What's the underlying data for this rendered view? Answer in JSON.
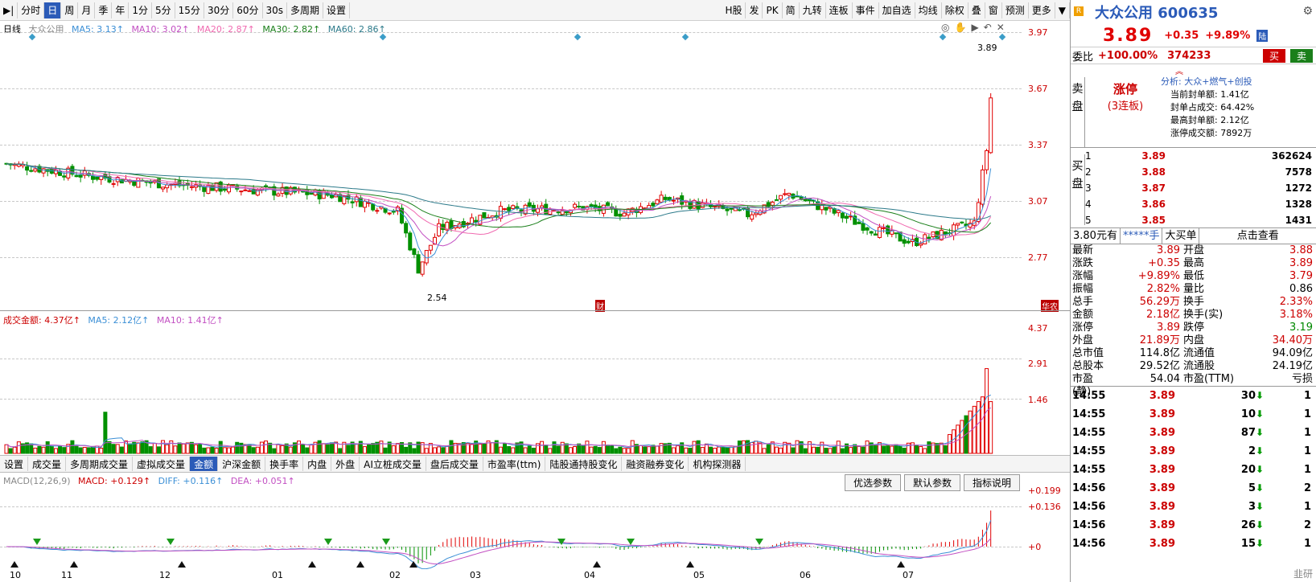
{
  "toolbar": {
    "left": [
      "分时",
      "日",
      "周",
      "月",
      "季",
      "年",
      "1分",
      "5分",
      "15分",
      "30分",
      "60分",
      "30s",
      "多周期",
      "设置"
    ],
    "active": "日",
    "right": [
      "H股",
      "发",
      "PK",
      "简",
      "九转",
      "连板",
      "事件",
      "加自选",
      "均线",
      "除权",
      "叠",
      "窗",
      "预测",
      "更多"
    ]
  },
  "price_pane": {
    "legend": {
      "name": "日线",
      "stock": "大众公用",
      "ma5": "MA5: 3.13↑",
      "ma10": "MA10: 3.02↑",
      "ma20": "MA20: 2.87↑",
      "ma30": "MA30: 2.82↑",
      "ma60": "MA60: 2.86↑"
    },
    "y_labels": [
      "3.97",
      "3.67",
      "3.37",
      "3.07",
      "2.77"
    ],
    "low_marker": "2.54",
    "last_marker": "3.89",
    "tag_cai": "财",
    "tag_ruixing": "华农"
  },
  "volume_pane": {
    "legend": {
      "amount": "成交金额: 4.37亿↑",
      "ma5": "MA5: 2.12亿↑",
      "ma10": "MA10: 1.41亿↑"
    },
    "y_labels": [
      "4.37",
      "2.91",
      "1.46"
    ]
  },
  "indicator_tabs": [
    "设置",
    "成交量",
    "多周期成交量",
    "虚拟成交量",
    "金额",
    "沪深金额",
    "换手率",
    "内盘",
    "外盘",
    "AI立桩成交量",
    "盘后成交量",
    "市盈率(ttm)",
    "陆股通持股变化",
    "融资融券变化",
    "机构探测器"
  ],
  "indicator_active": "金额",
  "macd_pane": {
    "legend": {
      "name": "MACD(12,26,9)",
      "macd": "MACD: +0.129↑",
      "diff": "DIFF: +0.116↑",
      "dea": "DEA: +0.051↑"
    },
    "buttons": [
      "优选参数",
      "默认参数",
      "指标说明"
    ],
    "y_labels": [
      "+0.199",
      "+0.136",
      "+0"
    ]
  },
  "date_axis": [
    "10",
    "11",
    "12",
    "01",
    "02",
    "03",
    "04",
    "05",
    "06",
    "07"
  ],
  "panel": {
    "name": "大众公用 600635",
    "price": "3.89",
    "change": "+0.35",
    "pct": "+9.89%",
    "tag": "陆",
    "weibi_label": "委比",
    "weibi": "+100.00%",
    "weicha": "374233",
    "buy_btn": "买",
    "sell_btn": "卖",
    "sell_label": "卖盘",
    "buy_label": "买盘",
    "limit_title": "涨停",
    "limit_sub": "(3连板)",
    "analysis": [
      "分析: 大众+燃气+创投",
      "当前封单额: 1.41亿",
      "封单占成交: 64.42%",
      "最高封单额: 2.12亿",
      "涨停成交额: 7892万"
    ],
    "buy_orders": [
      {
        "n": "1",
        "p": "3.89",
        "v": "362624"
      },
      {
        "n": "2",
        "p": "3.88",
        "v": "7578"
      },
      {
        "n": "3",
        "p": "3.87",
        "v": "1272"
      },
      {
        "n": "4",
        "p": "3.86",
        "v": "1328"
      },
      {
        "n": "5",
        "p": "3.85",
        "v": "1431"
      }
    ],
    "bigorder": [
      "3.80元有",
      "*****手",
      "大买单",
      "点击查看"
    ],
    "stats": [
      {
        "k1": "最新",
        "v1": "3.89",
        "k2": "开盘",
        "v2": "3.88"
      },
      {
        "k1": "涨跌",
        "v1": "+0.35",
        "k2": "最高",
        "v2": "3.89"
      },
      {
        "k1": "涨幅",
        "v1": "+9.89%",
        "k2": "最低",
        "v2": "3.79"
      },
      {
        "k1": "振幅",
        "v1": "2.82%",
        "k2": "量比",
        "v2": "0.86"
      },
      {
        "k1": "总手",
        "v1": "56.29万",
        "k2": "换手",
        "v2": "2.33%"
      },
      {
        "k1": "金额",
        "v1": "2.18亿",
        "k2": "换手(实)",
        "v2": "3.18%"
      },
      {
        "k1": "涨停",
        "v1": "3.89",
        "k2": "跌停",
        "v2": "3.19"
      },
      {
        "k1": "外盘",
        "v1": "21.89万",
        "k2": "内盘",
        "v2": "34.40万"
      },
      {
        "k1": "总市值",
        "v1": "114.8亿",
        "k2": "流通值",
        "v2": "94.09亿"
      },
      {
        "k1": "总股本",
        "v1": "29.52亿",
        "k2": "流通股",
        "v2": "24.19亿"
      },
      {
        "k1": "市盈(静)",
        "v1": "54.04",
        "k2": "市盈(TTM)",
        "v2": "亏损"
      }
    ],
    "ticks": [
      {
        "t": "14:55",
        "p": "3.89",
        "v": "30",
        "c": "1"
      },
      {
        "t": "14:55",
        "p": "3.89",
        "v": "10",
        "c": "1"
      },
      {
        "t": "14:55",
        "p": "3.89",
        "v": "87",
        "c": "1"
      },
      {
        "t": "14:55",
        "p": "3.89",
        "v": "2",
        "c": "1"
      },
      {
        "t": "14:55",
        "p": "3.89",
        "v": "20",
        "c": "1"
      },
      {
        "t": "14:56",
        "p": "3.89",
        "v": "5",
        "c": "2"
      },
      {
        "t": "14:56",
        "p": "3.89",
        "v": "3",
        "c": "1"
      },
      {
        "t": "14:56",
        "p": "3.89",
        "v": "26",
        "c": "2"
      },
      {
        "t": "14:56",
        "p": "3.89",
        "v": "15",
        "c": "1"
      }
    ],
    "watermark": "韭研"
  },
  "colors": {
    "up": "#e00000",
    "down": "#009000",
    "ma5": "#3b8fd6",
    "ma10": "#c24fc2",
    "ma20": "#f06ab0",
    "ma30": "#1a7f1a",
    "ma60": "#2c7a8a"
  }
}
